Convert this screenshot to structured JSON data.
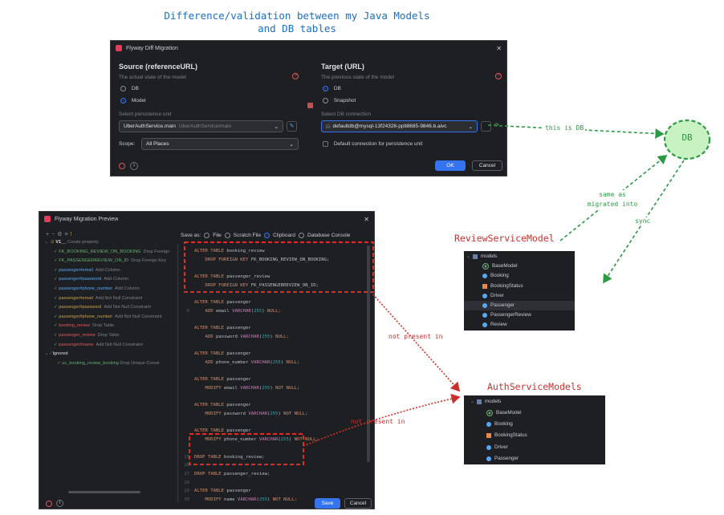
{
  "top_annotation": {
    "line1": "Difference/validation between my Java Models",
    "line2": "and DB tables"
  },
  "diff_dialog": {
    "title": "Flyway Diff Migration",
    "source": {
      "heading": "Source (referenceURL)",
      "desc": "The actual state of the model",
      "options": [
        "DB",
        "Model"
      ],
      "selected": "Model",
      "unit_label": "Select persistence unit",
      "unit_value": "UberAuthService.main",
      "unit_hint": "UberAuthService/main",
      "scope_label": "Scope:",
      "scope_value": "All Places"
    },
    "target": {
      "heading": "Target (URL)",
      "desc": "The previous state of the model",
      "options": [
        "DB",
        "Snapshot"
      ],
      "selected": "DB",
      "conn_label": "Select DB connection",
      "conn_value": "defaultdb@mysql-13f24328-pptl8685-9846.b.aivc",
      "default_conn": "Default connection for persistence unit"
    },
    "ok": "OK",
    "cancel": "Cancel"
  },
  "db_node": {
    "label": "DB"
  },
  "green_annotations": {
    "this_is_db": "this is DB",
    "same_as_line1": "same as",
    "same_as_line2": "migrated into",
    "sync": "sync"
  },
  "red_annotations": {
    "not_present_1": "not present in",
    "not_present_2": "not present in"
  },
  "review_model": {
    "title": "ReviewServiceModel",
    "folder": "models",
    "items": [
      {
        "label": "BaseModel",
        "icon": "abstract-class-icon",
        "selected": false
      },
      {
        "label": "Booking",
        "icon": "class-icon",
        "selected": false
      },
      {
        "label": "BookingStatus",
        "icon": "enum-icon",
        "selected": false
      },
      {
        "label": "Driver",
        "icon": "class-icon",
        "selected": false
      },
      {
        "label": "Passenger",
        "icon": "class-icon",
        "selected": true
      },
      {
        "label": "PassengerReview",
        "icon": "class-icon",
        "selected": false
      },
      {
        "label": "Review",
        "icon": "class-icon",
        "selected": false
      }
    ]
  },
  "auth_model": {
    "title": "AuthServiceModels",
    "folder": "models",
    "items": [
      {
        "label": "BaseModel",
        "icon": "abstract-class-icon"
      },
      {
        "label": "Booking",
        "icon": "class-icon"
      },
      {
        "label": "BookingStatus",
        "icon": "enum-icon"
      },
      {
        "label": "Driver",
        "icon": "class-icon"
      },
      {
        "label": "Passenger",
        "icon": "class-icon"
      }
    ]
  },
  "preview_dialog": {
    "title": "Flyway Migration Preview",
    "save_as_label": "Save as:",
    "save_options": [
      "File",
      "Scratch File",
      "Clipboard",
      "Database Console"
    ],
    "save_selected": "Clipboard",
    "root": {
      "label": "V1__",
      "hint": "Create property"
    },
    "tree": [
      {
        "name": "FK_BOOKING_REVIEW_ON_BOOKING",
        "action": "Drop Foreign",
        "color": "#6aab73"
      },
      {
        "name": "FK_PASSENGERREVIEW_ON_ID",
        "action": "Drop Foreign Key",
        "color": "#6aab73"
      },
      {
        "name": "passenger#email",
        "action": "Add Column",
        "color": "#56a8f5"
      },
      {
        "name": "passenger#password",
        "action": "Add Column",
        "color": "#56a8f5"
      },
      {
        "name": "passenger#phone_number",
        "action": "Add Column",
        "color": "#56a8f5"
      },
      {
        "name": "passenger#email",
        "action": "Add Not Null Constraint",
        "color": "#c7a24a"
      },
      {
        "name": "passenger#password",
        "action": "Add Not Null Constraint",
        "color": "#c7a24a"
      },
      {
        "name": "passenger#phone_number",
        "action": "Add Not Null Constraint",
        "color": "#c7a24a"
      },
      {
        "name": "booking_review",
        "action": "Drop Table",
        "color": "#e0575b"
      },
      {
        "name": "passenger_review",
        "action": "Drop Table",
        "color": "#e0575b"
      },
      {
        "name": "passenger#name",
        "action": "Add Not Null Constraint",
        "color": "#e0575b"
      }
    ],
    "ignored_label": "Ignored",
    "ignored_item": {
      "name": "uc_booking_review_booking",
      "action": "Drop Unique Constr"
    },
    "gutter": [
      "",
      "",
      "",
      "",
      "",
      "",
      "",
      "8",
      "",
      "",
      "",
      "",
      "",
      "",
      "",
      "",
      "",
      "",
      "",
      "",
      "",
      "",
      "",
      "",
      "",
      "",
      "",
      "",
      "",
      ""
    ],
    "gutter_bottom": [
      "25",
      "26",
      "27",
      "28",
      "29",
      "30"
    ],
    "save": "Save",
    "cancel": "Cancel"
  },
  "code_lines": [
    [
      {
        "t": "ALTER TABLE ",
        "c": "kw"
      },
      {
        "t": "booking_review",
        "c": ""
      }
    ],
    [
      {
        "t": "    DROP FOREIGN KEY ",
        "c": "kw"
      },
      {
        "t": "FK_BOOKING_REVIEW_ON_BOOKING;",
        "c": ""
      }
    ],
    [
      {
        "t": "",
        "c": ""
      }
    ],
    [
      {
        "t": "ALTER TABLE ",
        "c": "kw"
      },
      {
        "t": "passenger_review",
        "c": ""
      }
    ],
    [
      {
        "t": "    DROP FOREIGN KEY ",
        "c": "kw"
      },
      {
        "t": "FK_PASSENGERREVIEW_ON_ID;",
        "c": ""
      }
    ],
    [
      {
        "t": "",
        "c": ""
      }
    ],
    [
      {
        "t": "ALTER TABLE ",
        "c": "kw"
      },
      {
        "t": "passenger",
        "c": ""
      }
    ],
    [
      {
        "t": "    ADD ",
        "c": "kw"
      },
      {
        "t": "email ",
        "c": ""
      },
      {
        "t": "VARCHAR",
        "c": "ty"
      },
      {
        "t": "(",
        "c": ""
      },
      {
        "t": "255",
        "c": "nu"
      },
      {
        "t": ") ",
        "c": ""
      },
      {
        "t": "NULL;",
        "c": "kw"
      }
    ],
    [
      {
        "t": "",
        "c": ""
      }
    ],
    [
      {
        "t": "ALTER TABLE ",
        "c": "kw"
      },
      {
        "t": "passenger",
        "c": ""
      }
    ],
    [
      {
        "t": "    ADD ",
        "c": "kw"
      },
      {
        "t": "password ",
        "c": ""
      },
      {
        "t": "VARCHAR",
        "c": "ty"
      },
      {
        "t": "(",
        "c": ""
      },
      {
        "t": "255",
        "c": "nu"
      },
      {
        "t": ") ",
        "c": ""
      },
      {
        "t": "NULL;",
        "c": "kw"
      }
    ],
    [
      {
        "t": "",
        "c": ""
      }
    ],
    [
      {
        "t": "ALTER TABLE ",
        "c": "kw"
      },
      {
        "t": "passenger",
        "c": ""
      }
    ],
    [
      {
        "t": "    ADD ",
        "c": "kw"
      },
      {
        "t": "phone_number ",
        "c": ""
      },
      {
        "t": "VARCHAR",
        "c": "ty"
      },
      {
        "t": "(",
        "c": ""
      },
      {
        "t": "255",
        "c": "nu"
      },
      {
        "t": ") ",
        "c": ""
      },
      {
        "t": "NULL;",
        "c": "kw"
      }
    ],
    [
      {
        "t": "",
        "c": ""
      }
    ],
    [
      {
        "t": "ALTER TABLE ",
        "c": "kw"
      },
      {
        "t": "passenger",
        "c": ""
      }
    ],
    [
      {
        "t": "    MODIFY ",
        "c": "kw"
      },
      {
        "t": "email ",
        "c": ""
      },
      {
        "t": "VARCHAR",
        "c": "ty"
      },
      {
        "t": "(",
        "c": ""
      },
      {
        "t": "255",
        "c": "nu"
      },
      {
        "t": ") ",
        "c": ""
      },
      {
        "t": "NOT NULL;",
        "c": "kw"
      }
    ],
    [
      {
        "t": "",
        "c": ""
      }
    ],
    [
      {
        "t": "ALTER TABLE ",
        "c": "kw"
      },
      {
        "t": "passenger",
        "c": ""
      }
    ],
    [
      {
        "t": "    MODIFY ",
        "c": "kw"
      },
      {
        "t": "password ",
        "c": ""
      },
      {
        "t": "VARCHAR",
        "c": "ty"
      },
      {
        "t": "(",
        "c": ""
      },
      {
        "t": "255",
        "c": "nu"
      },
      {
        "t": ") ",
        "c": ""
      },
      {
        "t": "NOT NULL;",
        "c": "kw"
      }
    ],
    [
      {
        "t": "",
        "c": ""
      }
    ],
    [
      {
        "t": "ALTER TABLE ",
        "c": "kw"
      },
      {
        "t": "passenger",
        "c": ""
      }
    ],
    [
      {
        "t": "    MODIFY ",
        "c": "kw"
      },
      {
        "t": "phone_number ",
        "c": ""
      },
      {
        "t": "VARCHAR",
        "c": "ty"
      },
      {
        "t": "(",
        "c": ""
      },
      {
        "t": "255",
        "c": "nu"
      },
      {
        "t": ") ",
        "c": ""
      },
      {
        "t": "NOT NULL;",
        "c": "kw"
      }
    ],
    [
      {
        "t": "",
        "c": ""
      }
    ],
    [
      {
        "t": "DROP TABLE ",
        "c": "kw"
      },
      {
        "t": "booking_review;",
        "c": ""
      }
    ],
    [
      {
        "t": "",
        "c": ""
      }
    ],
    [
      {
        "t": "DROP TABLE ",
        "c": "kw"
      },
      {
        "t": "passenger_review;",
        "c": ""
      }
    ],
    [
      {
        "t": "",
        "c": ""
      }
    ],
    [
      {
        "t": "ALTER TABLE ",
        "c": "kw"
      },
      {
        "t": "passenger",
        "c": ""
      }
    ],
    [
      {
        "t": "    MODIFY ",
        "c": "kw"
      },
      {
        "t": "name ",
        "c": ""
      },
      {
        "t": "VARCHAR",
        "c": "ty"
      },
      {
        "t": "(",
        "c": ""
      },
      {
        "t": "255",
        "c": "nu"
      },
      {
        "t": ") ",
        "c": ""
      },
      {
        "t": "NOT NULL;",
        "c": "kw"
      }
    ]
  ],
  "colors": {
    "annotation_green": "#2b9a44",
    "annotation_red": "#c9302c",
    "db_fill": "#c9f2c2",
    "accent_blue": "#3574f0",
    "title_blue": "#1a6fc4"
  }
}
